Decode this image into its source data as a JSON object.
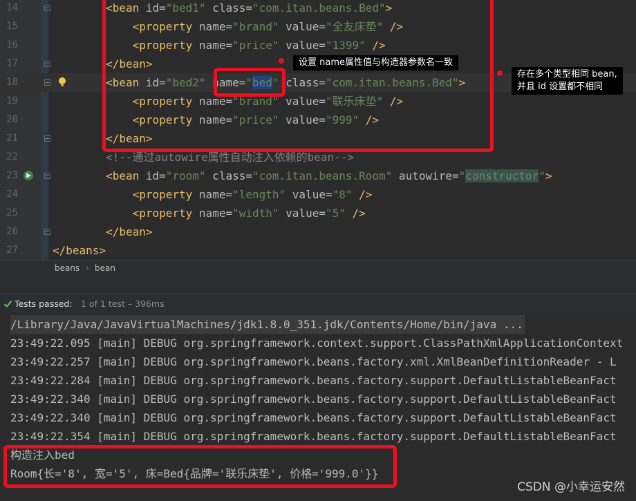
{
  "editor": {
    "lines": [
      {
        "num": "14",
        "segments": [
          {
            "t": "        "
          },
          {
            "t": "<bean ",
            "c": "tag"
          },
          {
            "t": "id=",
            "c": "attr"
          },
          {
            "t": "\"bed1\"",
            "c": "val"
          },
          {
            "t": " class=",
            "c": "attr"
          },
          {
            "t": "\"com.itan.beans.Bed\"",
            "c": "val"
          },
          {
            "t": ">",
            "c": "tag"
          }
        ]
      },
      {
        "num": "15",
        "segments": [
          {
            "t": "            "
          },
          {
            "t": "<property ",
            "c": "tag"
          },
          {
            "t": "name=",
            "c": "attr"
          },
          {
            "t": "\"brand\"",
            "c": "val"
          },
          {
            "t": " value=",
            "c": "attr"
          },
          {
            "t": "\"全友床垫\"",
            "c": "val"
          },
          {
            "t": " />",
            "c": "tag"
          }
        ]
      },
      {
        "num": "16",
        "segments": [
          {
            "t": "            "
          },
          {
            "t": "<property ",
            "c": "tag"
          },
          {
            "t": "name=",
            "c": "attr"
          },
          {
            "t": "\"price\"",
            "c": "val"
          },
          {
            "t": " value=",
            "c": "attr"
          },
          {
            "t": "\"1399\"",
            "c": "val"
          },
          {
            "t": " />",
            "c": "tag"
          }
        ]
      },
      {
        "num": "17",
        "segments": [
          {
            "t": "        "
          },
          {
            "t": "</bean>",
            "c": "tag"
          }
        ]
      },
      {
        "num": "18",
        "current": true,
        "segments": [
          {
            "t": "        "
          },
          {
            "t": "<bean ",
            "c": "tag"
          },
          {
            "t": "id=",
            "c": "attr"
          },
          {
            "t": "\"bed2\"",
            "c": "val"
          },
          {
            "t": " name=",
            "c": "attr"
          },
          {
            "t": "\"",
            "c": "val"
          },
          {
            "t": "bed",
            "c": "val hl-sel"
          },
          {
            "t": "\"",
            "c": "val"
          },
          {
            "t": " class=",
            "c": "attr"
          },
          {
            "t": "\"com.itan.beans.Bed\"",
            "c": "val"
          },
          {
            "t": ">",
            "c": "tag"
          }
        ]
      },
      {
        "num": "19",
        "segments": [
          {
            "t": "            "
          },
          {
            "t": "<property ",
            "c": "tag"
          },
          {
            "t": "name=",
            "c": "attr"
          },
          {
            "t": "\"brand\"",
            "c": "val"
          },
          {
            "t": " value=",
            "c": "attr"
          },
          {
            "t": "\"联乐床垫\"",
            "c": "val"
          },
          {
            "t": " />",
            "c": "tag"
          }
        ]
      },
      {
        "num": "20",
        "segments": [
          {
            "t": "            "
          },
          {
            "t": "<property ",
            "c": "tag"
          },
          {
            "t": "name=",
            "c": "attr"
          },
          {
            "t": "\"price\"",
            "c": "val"
          },
          {
            "t": " value=",
            "c": "attr"
          },
          {
            "t": "\"999\"",
            "c": "val"
          },
          {
            "t": " />",
            "c": "tag"
          }
        ]
      },
      {
        "num": "21",
        "segments": [
          {
            "t": "        "
          },
          {
            "t": "</bean>",
            "c": "tag"
          }
        ]
      },
      {
        "num": "22",
        "segments": [
          {
            "t": "        "
          },
          {
            "t": "<!--通过autowire属性自动注入依赖的bean-->",
            "c": "cmt"
          }
        ]
      },
      {
        "num": "23",
        "segments": [
          {
            "t": "        "
          },
          {
            "t": "<bean ",
            "c": "tag"
          },
          {
            "t": "id=",
            "c": "attr"
          },
          {
            "t": "\"room\"",
            "c": "val"
          },
          {
            "t": " class=",
            "c": "attr"
          },
          {
            "t": "\"com.itan.beans.Room\"",
            "c": "val"
          },
          {
            "t": " autowire=",
            "c": "attr"
          },
          {
            "t": "\"",
            "c": "val"
          },
          {
            "t": "constructor",
            "c": "val hl-ctor"
          },
          {
            "t": "\"",
            "c": "val"
          },
          {
            "t": ">",
            "c": "tag"
          }
        ]
      },
      {
        "num": "24",
        "segments": [
          {
            "t": "            "
          },
          {
            "t": "<property ",
            "c": "tag"
          },
          {
            "t": "name=",
            "c": "attr"
          },
          {
            "t": "\"length\"",
            "c": "val"
          },
          {
            "t": " value=",
            "c": "attr"
          },
          {
            "t": "\"8\"",
            "c": "val"
          },
          {
            "t": " />",
            "c": "tag"
          }
        ]
      },
      {
        "num": "25",
        "segments": [
          {
            "t": "            "
          },
          {
            "t": "<property ",
            "c": "tag"
          },
          {
            "t": "name=",
            "c": "attr"
          },
          {
            "t": "\"width\"",
            "c": "val"
          },
          {
            "t": " value=",
            "c": "attr"
          },
          {
            "t": "\"5\"",
            "c": "val"
          },
          {
            "t": " />",
            "c": "tag"
          }
        ]
      },
      {
        "num": "26",
        "segments": [
          {
            "t": "        "
          },
          {
            "t": "</bean>",
            "c": "tag"
          }
        ]
      },
      {
        "num": "27",
        "segments": [
          {
            "t": ""
          },
          {
            "t": "</beans>",
            "c": "tag"
          }
        ]
      }
    ]
  },
  "annotations": {
    "name_note": "设置 name属性值与构造器参数名一致",
    "bean_note": "存在多个类型相同 bean,\n并且 id 设置都不相同"
  },
  "breadcrumb": {
    "root": "beans",
    "sep": "›",
    "leaf": "bean"
  },
  "tests": {
    "status": "Tests passed:",
    "detail": "1 of 1 test – 396ms"
  },
  "console": {
    "lines": [
      {
        "text": "/Library/Java/JavaVirtualMachines/jdk1.8.0_351.jdk/Contents/Home/bin/java ...",
        "kind": "path"
      },
      {
        "text": "23:49:22.095 [main] DEBUG org.springframework.context.support.ClassPathXmlApplicationContext",
        "kind": "log"
      },
      {
        "text": "23:49:22.257 [main] DEBUG org.springframework.beans.factory.xml.XmlBeanDefinitionReader - L",
        "kind": "log"
      },
      {
        "text": "23:49:22.284 [main] DEBUG org.springframework.beans.factory.support.DefaultListableBeanFact",
        "kind": "log"
      },
      {
        "text": "23:49:22.340 [main] DEBUG org.springframework.beans.factory.support.DefaultListableBeanFact",
        "kind": "log"
      },
      {
        "text": "23:49:22.340 [main] DEBUG org.springframework.beans.factory.support.DefaultListableBeanFact",
        "kind": "log"
      },
      {
        "text": "23:49:22.354 [main] DEBUG org.springframework.beans.factory.support.DefaultListableBeanFact",
        "kind": "log"
      },
      {
        "text": "构造注入bed",
        "kind": "out"
      },
      {
        "text": "Room{长='8', 宽='5', 床=Bed{品牌='联乐床垫', 价格='999.0'}}",
        "kind": "out"
      }
    ]
  },
  "watermark": "CSDN @小幸运安然",
  "colors": {
    "accent_red": "#e81123",
    "tag": "#e8bf6a",
    "value": "#6a8759",
    "pass_green": "#5fb85f"
  }
}
